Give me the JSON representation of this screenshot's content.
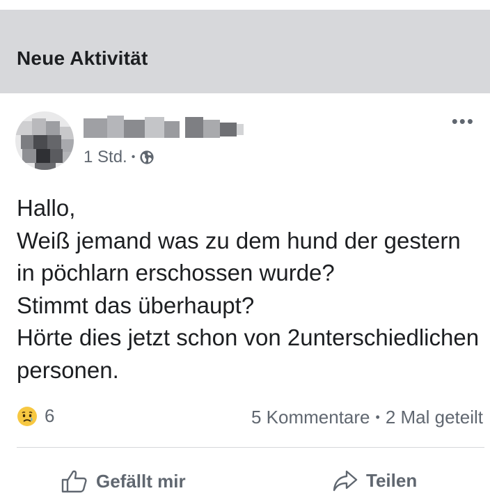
{
  "section": {
    "title": "Neue Aktivität"
  },
  "post": {
    "author_name": "",
    "time": "1 Std.",
    "meta_separator": "•",
    "privacy_icon": "globe-icon",
    "more_icon": "more-options-icon",
    "more_glyph": "•••",
    "text": "Hallo,\nWeiß jemand was zu dem hund der gestern in pöchlarn erschossen wurde?\nStimmt das überhaupt?\nHörte dies jetzt schon von 2unterschiedlichen personen.",
    "reaction_icon": "sad-emoji-icon",
    "reaction_count": "6",
    "comments": "5 Kommentare",
    "stats_separator": "•",
    "shares": "2 Mal geteilt"
  },
  "actions": {
    "like_label": "Gefällt mir",
    "like_icon": "thumbs-up-icon",
    "share_label": "Teilen",
    "share_icon": "share-arrow-icon"
  },
  "colors": {
    "header_bg": "#d7d8db",
    "text_primary": "#1c1e21",
    "text_secondary": "#606770",
    "divider": "#d6d7da",
    "emoji_yellow": "#f7c842"
  }
}
